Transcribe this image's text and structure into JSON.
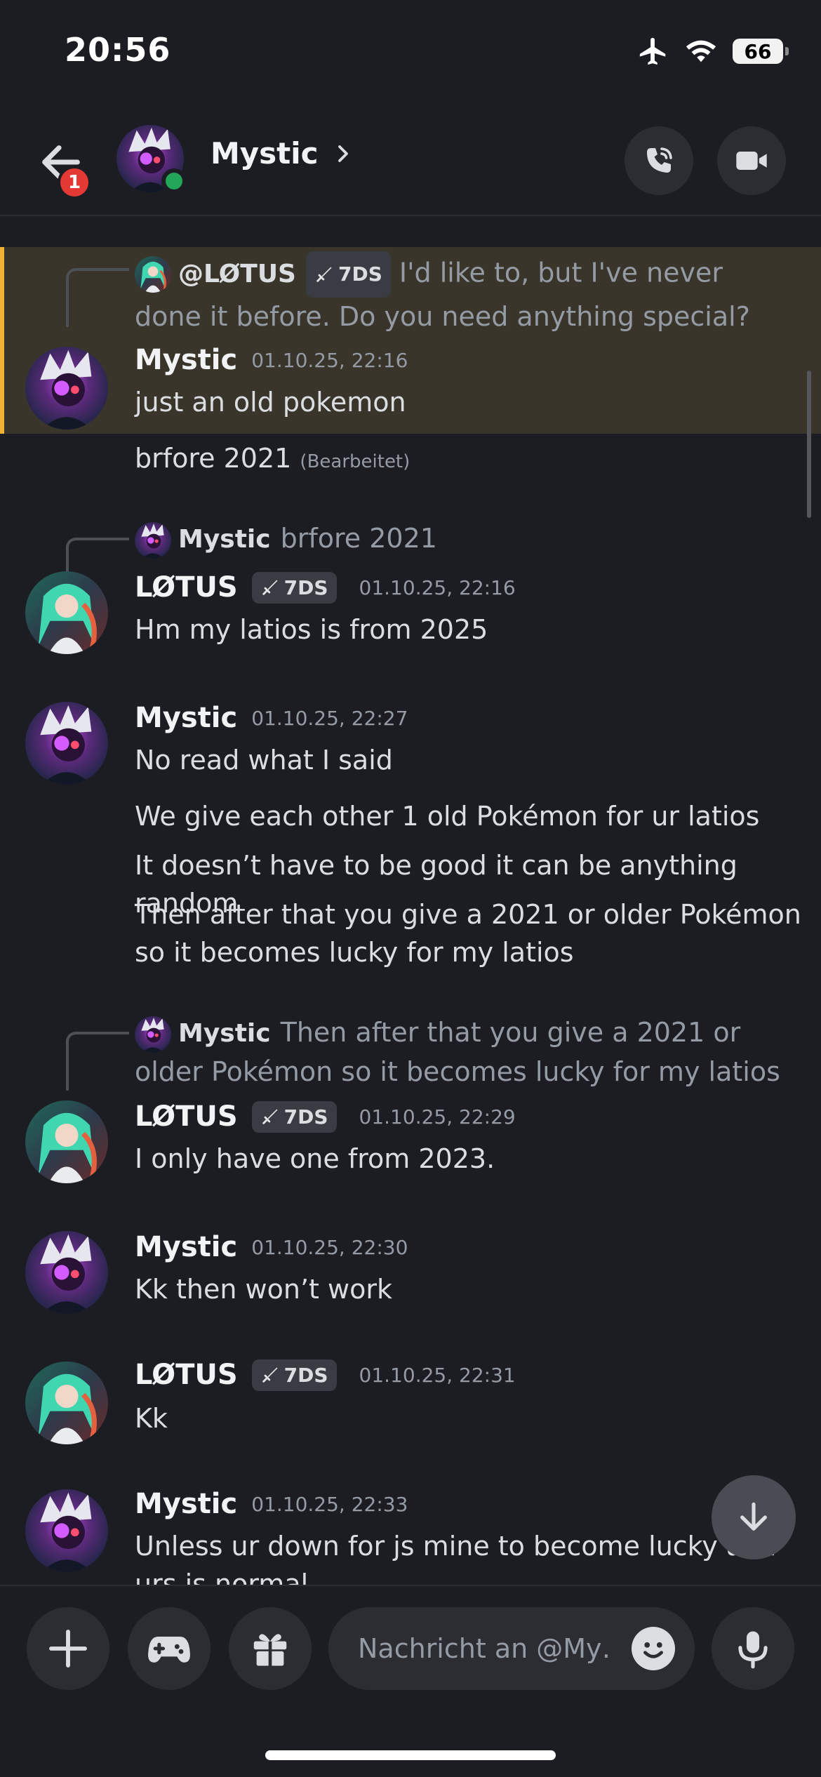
{
  "status_bar": {
    "time": "20:56",
    "battery": "66"
  },
  "header": {
    "title": "Mystic",
    "back_badge": "1"
  },
  "messages": [
    {
      "reply": {
        "name": "@LØTUS",
        "tag": "7DS",
        "text": "I'd like to, but I've never done it before. Do you need anything special?"
      },
      "author": "Mystic",
      "timestamp": "01.10.25, 22:16",
      "lines": [
        "just an old pokemon"
      ]
    },
    {
      "continuation": "brfore 2021",
      "edited": "(Bearbeitet)"
    },
    {
      "reply": {
        "name": "Mystic",
        "text": "brfore 2021"
      },
      "author": "LØTUS",
      "tag": "7DS",
      "timestamp": "01.10.25, 22:16",
      "lines": [
        "Hm my latios is from 2025"
      ]
    },
    {
      "author": "Mystic",
      "timestamp": "01.10.25, 22:27",
      "lines": [
        "No read what I said",
        "We give each other 1 old Pokémon for ur latios",
        "It doesn’t have to be good it can be anything random",
        "Then after that you give a 2021 or older Pokémon so it becomes lucky for my latios"
      ]
    },
    {
      "reply": {
        "name": "Mystic",
        "text": "Then after that you give a 2021 or older Pokémon so it becomes lucky for my latios"
      },
      "author": "LØTUS",
      "tag": "7DS",
      "timestamp": "01.10.25, 22:29",
      "lines": [
        "I only have one from 2023."
      ]
    },
    {
      "author": "Mystic",
      "timestamp": "01.10.25, 22:30",
      "lines": [
        "Kk then won’t work"
      ]
    },
    {
      "author": "LØTUS",
      "tag": "7DS",
      "timestamp": "01.10.25, 22:31",
      "lines": [
        "Kk"
      ]
    },
    {
      "author": "Mystic",
      "timestamp": "01.10.25, 22:33",
      "lines": [
        "Unless ur down for js mine to become lucky and urs is normal"
      ]
    }
  ],
  "composer": {
    "placeholder": "Nachricht an @My…"
  },
  "colors": {
    "background": "#1c1d22",
    "highlight": "#39352a",
    "highlight_bar": "#f0b232",
    "online": "#23a55a",
    "badge": "#e53935"
  },
  "icons": [
    "airplane-icon",
    "wifi-icon",
    "back-arrow-icon",
    "chevron-right-icon",
    "phone-call-icon",
    "video-camera-icon",
    "sword-icon",
    "arrow-down-icon",
    "plus-icon",
    "gamepad-icon",
    "gift-icon",
    "emoji-icon",
    "microphone-icon"
  ]
}
